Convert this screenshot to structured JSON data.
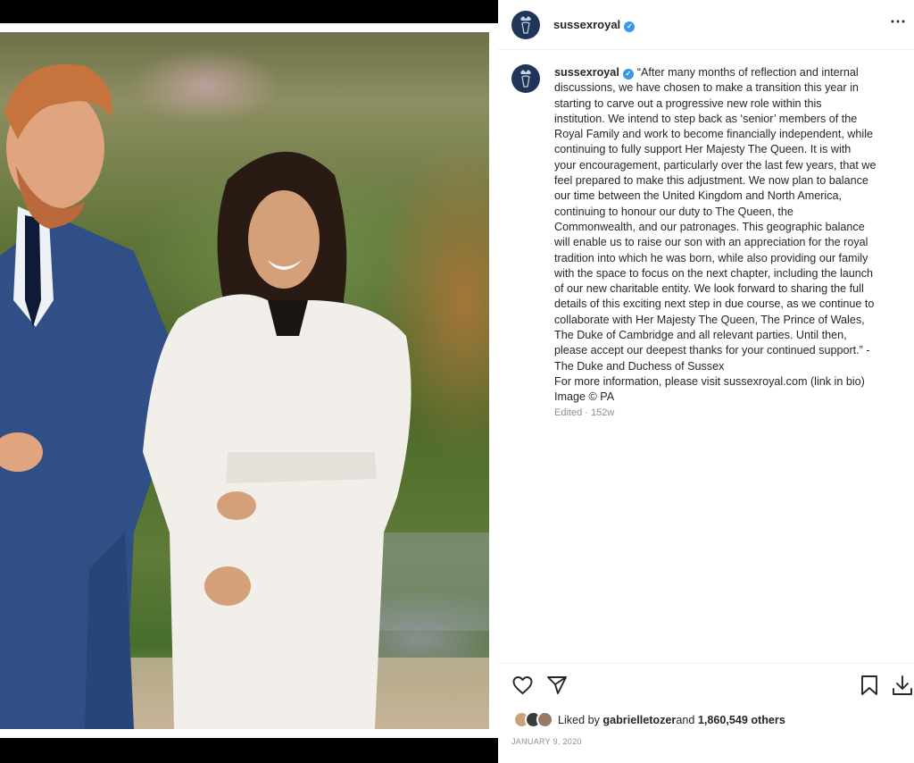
{
  "post": {
    "username": "sussexroyal",
    "more_icon": "⋯",
    "caption_lines": [
      "“After many months of reflection and internal",
      "discussions, we have chosen to make a transition this year in",
      "starting to carve out a progressive new role within this",
      "institution. We intend to step back as ‘senior’ members of the",
      "Royal Family and work to become financially independent, while",
      "continuing to fully support Her Majesty The Queen. It is with",
      "your encouragement, particularly over the last few years, that we",
      "feel prepared to make this adjustment. We now plan to balance",
      "our time between the United Kingdom and North America,",
      "continuing to honour our duty to The Queen, the",
      "Commonwealth, and our patronages. This geographic balance",
      "will enable us to raise our son with an appreciation for the royal",
      "tradition into which he was born, while also providing our family",
      "with the space to focus on the next chapter, including the launch",
      "of our new charitable entity. We look forward to sharing the full",
      "details of this exciting next step in due course, as we continue to",
      "collaborate with Her Majesty The Queen, The Prince of Wales,",
      "The Duke of Cambridge and all relevant parties. Until then,",
      "please accept our deepest thanks for your continued support.” -",
      "The Duke and Duchess of Sussex"
    ],
    "more_info": "For more information, please visit sussexroyal.com (link in bio)",
    "image_credit": "Image © PA",
    "edited": "Edited · 152w",
    "liked_prefix": "Liked by ",
    "liked_user": "gabrielletozer",
    "liked_and": " and ",
    "liked_count": "1,860,549 others",
    "date": "JANUARY 9, 2020"
  },
  "colors": {
    "verified": "#3897f0",
    "avatar_bg": "#1f3658",
    "text": "#262626",
    "muted": "#8e8e8e"
  },
  "icons": [
    "verified-badge-icon",
    "more-options-icon",
    "heart-icon",
    "share-icon",
    "bookmark-icon",
    "download-icon",
    "crest-icon"
  ]
}
